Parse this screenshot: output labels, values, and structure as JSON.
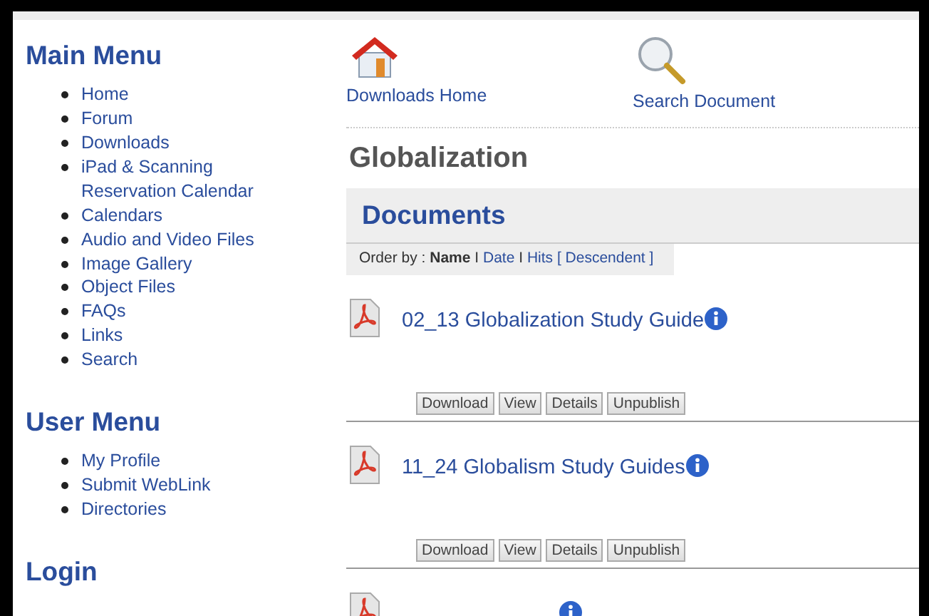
{
  "sidebar": [
    {
      "title": "Main Menu",
      "items": [
        {
          "label": "Home"
        },
        {
          "label": "Forum"
        },
        {
          "label": "Downloads"
        },
        {
          "label": "iPad & Scanning Reservation Calendar"
        },
        {
          "label": "Calendars"
        },
        {
          "label": "Audio and Video Files"
        },
        {
          "label": "Image Gallery"
        },
        {
          "label": "Object Files"
        },
        {
          "label": "FAQs"
        },
        {
          "label": "Links"
        },
        {
          "label": "Search"
        }
      ]
    },
    {
      "title": "User Menu",
      "items": [
        {
          "label": "My Profile"
        },
        {
          "label": "Submit WebLink"
        },
        {
          "label": "Directories"
        }
      ]
    },
    {
      "title": "Login"
    }
  ],
  "toolbar": [
    {
      "kind": "home",
      "label": "Downloads Home"
    },
    {
      "kind": "search",
      "label": "Search Document"
    }
  ],
  "category_title": "Globalization",
  "section_title": "Documents",
  "order_by": {
    "label": "Order by :",
    "options": [
      {
        "label": "Name",
        "selected": true,
        "separator": "I"
      },
      {
        "label": "Date",
        "selected": false,
        "separator": "I"
      },
      {
        "label": "Hits",
        "selected": false
      }
    ],
    "direction": "[ Descendent ]"
  },
  "documents": [
    {
      "title": "02_13 Globalization Study Guide",
      "info": true,
      "buttons": [
        "Download",
        "View",
        "Details",
        "Unpublish"
      ]
    },
    {
      "title": "11_24 Globalism Study Guides",
      "info": true,
      "buttons": [
        "Download",
        "View",
        "Details",
        "Unpublish"
      ]
    },
    {
      "info": true
    }
  ]
}
